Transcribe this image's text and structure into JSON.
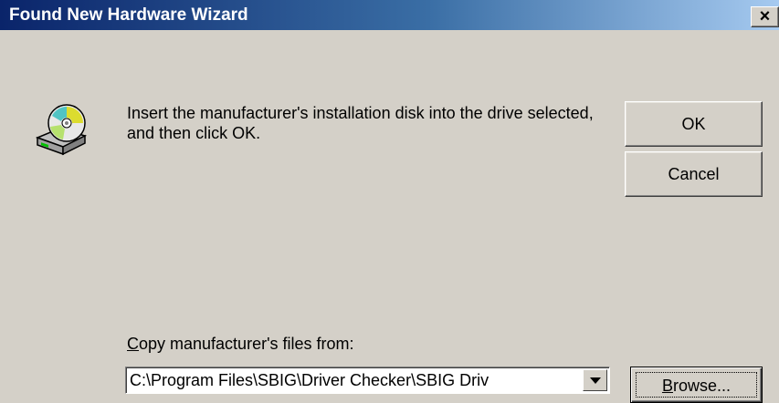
{
  "window": {
    "title": "Found New Hardware Wizard",
    "close_label": "×"
  },
  "dialog": {
    "message": "Insert the manufacturer's installation disk into the drive selected, and then click OK.",
    "icon": "cd-disk-drive-icon"
  },
  "buttons": {
    "ok_label": "OK",
    "cancel_label": "Cancel",
    "browse_label": "Browse...",
    "browse_mnemonic": "B",
    "browse_rest": "rowse..."
  },
  "copy_from": {
    "label": "Copy manufacturer's files from:",
    "label_mnemonic": "C",
    "label_rest": "opy manufacturer's files from:",
    "value": "C:\\Program Files\\SBIG\\Driver Checker\\SBIG Driv"
  },
  "colors": {
    "window_bg": "#d4d0c8",
    "titlebar_start": "#0a246a",
    "titlebar_end": "#a6caf0"
  }
}
